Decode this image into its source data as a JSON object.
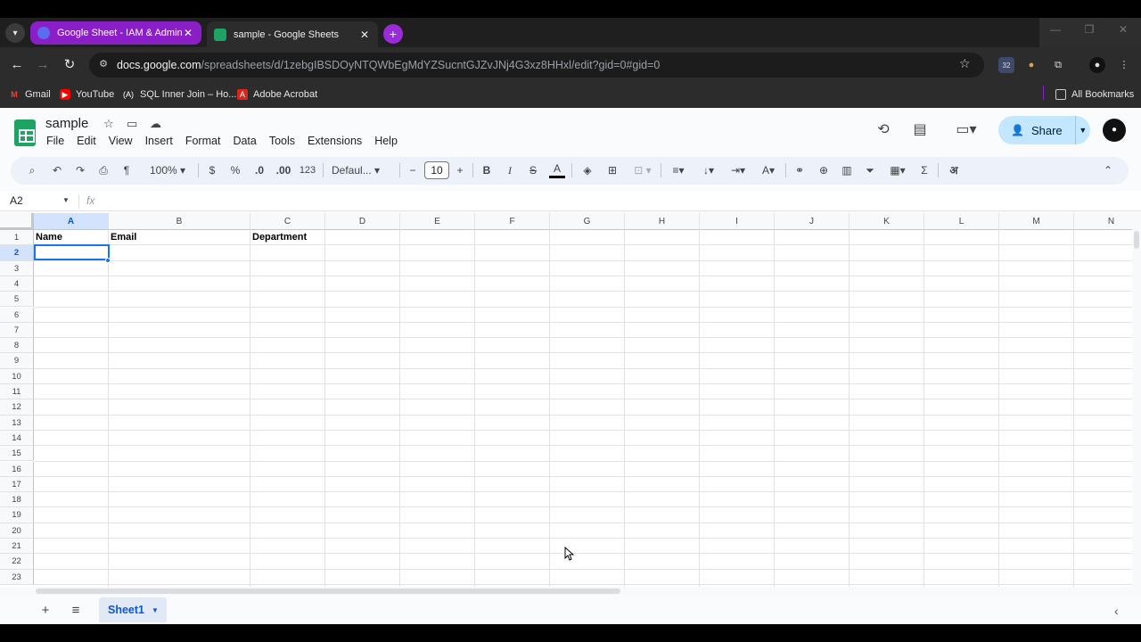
{
  "browser": {
    "tabs": [
      {
        "title": "Google Sheet - IAM & Admin",
        "active": false
      },
      {
        "title": "sample - Google Sheets",
        "active": true
      }
    ],
    "url_host": "docs.google.com",
    "url_path": "/spreadsheets/d/1zebgIBSDOyNTQWbEgMdYZSucntGJZvJNj4G3xz8HHxl/edit?gid=0#gid=0",
    "extension_badge": "32",
    "bookmarks": [
      "Gmail",
      "YouTube",
      "SQL Inner Join – Ho...",
      "Adobe Acrobat"
    ],
    "all_bookmarks": "All Bookmarks"
  },
  "sheet": {
    "title": "sample",
    "menus": [
      "File",
      "Edit",
      "View",
      "Insert",
      "Format",
      "Data",
      "Tools",
      "Extensions",
      "Help"
    ],
    "share_label": "Share",
    "toolbar": {
      "zoom": "100%",
      "currency": "$",
      "percent": "%",
      "dec_decrease": ".0",
      "dec_increase": ".00",
      "number_format": "123",
      "font": "Defaul...",
      "font_size": "10",
      "bold": "B",
      "italic": "I",
      "input_tools": "अ"
    },
    "name_box": "A2",
    "fx": "fx",
    "columns": [
      "A",
      "B",
      "C",
      "D",
      "E",
      "F",
      "G",
      "H",
      "I",
      "J",
      "K",
      "L",
      "M",
      "N"
    ],
    "rows": [
      "1",
      "2",
      "3",
      "4",
      "5",
      "6",
      "7",
      "8",
      "9",
      "10",
      "11",
      "12",
      "13",
      "14",
      "15",
      "16",
      "17",
      "18",
      "19",
      "20",
      "21",
      "22",
      "23"
    ],
    "cells": {
      "A1": "Name",
      "B1": "Email",
      "C1": "Department"
    },
    "selected_cell": "A2",
    "sheet_tab": "Sheet1"
  },
  "colors": {
    "accent": "#1a73e8",
    "share_bg": "#c2e7ff",
    "sheets_green": "#1ea362",
    "tab_purple": "#8a1ec7"
  }
}
